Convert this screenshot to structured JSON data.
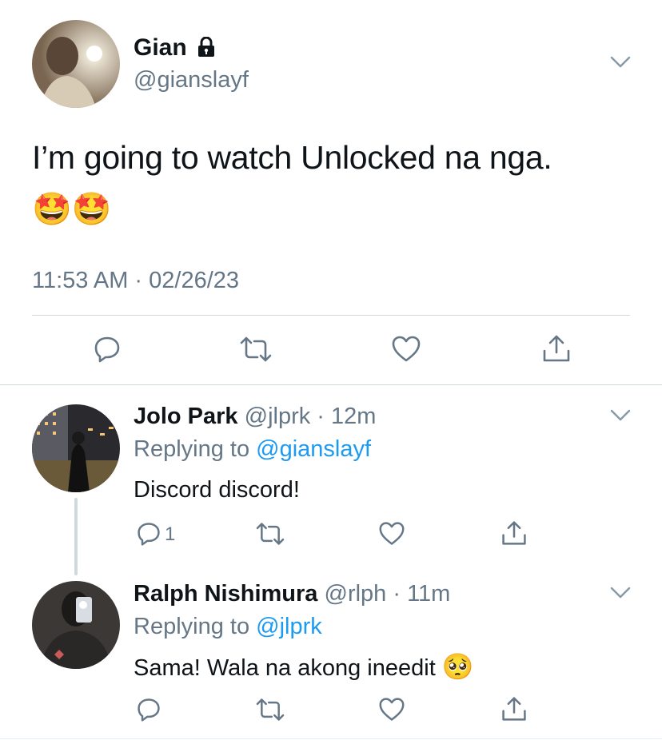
{
  "main_tweet": {
    "display_name": "Gian",
    "handle": "@gianslayf",
    "text": "I’m going to watch Unlocked na nga.",
    "emoji": "🤩🤩",
    "timestamp": "11:53 AM · 02/26/23",
    "locked": true
  },
  "replies": [
    {
      "display_name": "Jolo Park",
      "meta": "@jlprk · 12m",
      "replying_prefix": "Replying to",
      "replying_to": "@gianslayf",
      "text": "Discord discord!",
      "reply_count": "1"
    },
    {
      "display_name": "Ralph Nishimura",
      "meta": "@rlph · 11m",
      "replying_prefix": "Replying to",
      "replying_to": "@jlprk",
      "text": "Sama! Wala na akong ineedit",
      "emoji": "🥺"
    }
  ],
  "colors": {
    "text": "#0f1419",
    "secondary": "#657786",
    "link": "#1d9bf0",
    "divider": "#cfd9de",
    "thread_line": "#cfd9de"
  },
  "icons": [
    "lock-icon",
    "chevron-down-icon",
    "reply-icon",
    "retweet-icon",
    "like-icon",
    "share-icon"
  ]
}
